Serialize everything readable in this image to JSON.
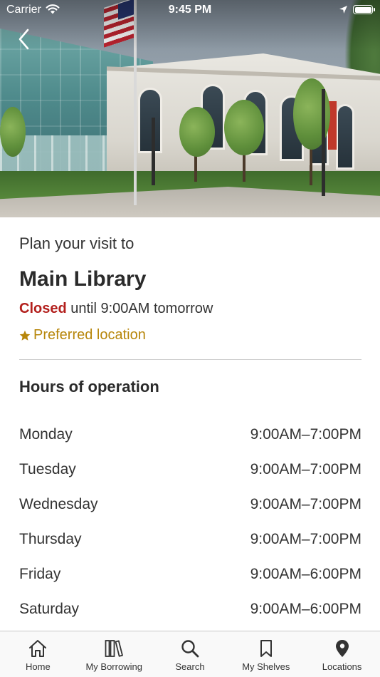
{
  "status_bar": {
    "carrier": "Carrier",
    "time": "9:45 PM"
  },
  "hero": {
    "image": "library-building-photo"
  },
  "location": {
    "intro": "Plan your visit to",
    "name": "Main Library",
    "status_label": "Closed",
    "status_detail": "until 9:00AM tomorrow",
    "preferred_label": "Preferred location"
  },
  "hours": {
    "heading": "Hours of operation",
    "rows": [
      {
        "day": "Monday",
        "time": "9:00AM–7:00PM"
      },
      {
        "day": "Tuesday",
        "time": "9:00AM–7:00PM"
      },
      {
        "day": "Wednesday",
        "time": "9:00AM–7:00PM"
      },
      {
        "day": "Thursday",
        "time": "9:00AM–7:00PM"
      },
      {
        "day": "Friday",
        "time": "9:00AM–6:00PM"
      },
      {
        "day": "Saturday",
        "time": "9:00AM–6:00PM"
      }
    ]
  },
  "tab_bar": {
    "tabs": [
      {
        "label": "Home",
        "icon": "home-icon"
      },
      {
        "label": "My Borrowing",
        "icon": "books-icon"
      },
      {
        "label": "Search",
        "icon": "search-icon"
      },
      {
        "label": "My Shelves",
        "icon": "bookmark-icon"
      },
      {
        "label": "Locations",
        "icon": "map-pin-icon"
      }
    ]
  },
  "colors": {
    "closed": "#b3201d",
    "preferred": "#b7860b",
    "divider": "#cfcfcf"
  }
}
